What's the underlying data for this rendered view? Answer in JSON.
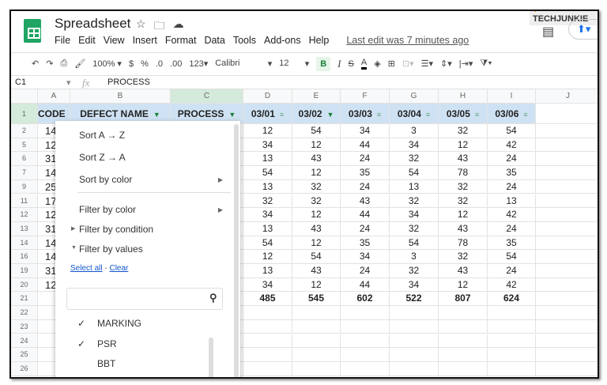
{
  "app": {
    "title": "Spreadsheet",
    "last_edit": "Last edit was 7 minutes ago",
    "brand": "TECHJUNKIE"
  },
  "menu": [
    "File",
    "Edit",
    "View",
    "Insert",
    "Format",
    "Data",
    "Tools",
    "Add-ons",
    "Help"
  ],
  "toolbar": {
    "zoom": "100%",
    "currency": "$",
    "percent": "%",
    "dec_less": ".0",
    "dec_more": ".00",
    "format": "123",
    "font": "Calibri",
    "size": "12",
    "bold": "B",
    "italic": "I",
    "strike": "S",
    "text_color": "A"
  },
  "formula": {
    "cell": "C1",
    "fx": "fx",
    "value": "PROCESS"
  },
  "columns": [
    "A",
    "B",
    "C",
    "D",
    "E",
    "F",
    "G",
    "H",
    "I",
    "J"
  ],
  "headers": [
    "CODE",
    "DEFECT NAME",
    "PROCESS",
    "03/01",
    "03/02",
    "03/03",
    "03/04",
    "03/05",
    "03/06"
  ],
  "row_numbers": [
    "1",
    "2",
    "5",
    "6",
    "7",
    "9",
    "11",
    "12",
    "13",
    "14",
    "16",
    "19",
    "20",
    "21",
    "22",
    "23",
    "24",
    "25",
    "26"
  ],
  "col_a": [
    "14",
    "12",
    "31",
    "14",
    "25",
    "17",
    "12",
    "31",
    "14",
    "14",
    "31",
    "12"
  ],
  "data": [
    [
      12,
      54,
      34,
      3,
      32,
      54
    ],
    [
      34,
      12,
      44,
      34,
      12,
      42
    ],
    [
      13,
      43,
      24,
      32,
      43,
      24
    ],
    [
      54,
      12,
      35,
      54,
      78,
      35
    ],
    [
      13,
      32,
      24,
      13,
      32,
      24
    ],
    [
      32,
      32,
      43,
      32,
      32,
      13
    ],
    [
      34,
      12,
      44,
      34,
      12,
      42
    ],
    [
      13,
      43,
      24,
      32,
      43,
      24
    ],
    [
      54,
      12,
      35,
      54,
      78,
      35
    ],
    [
      12,
      54,
      34,
      3,
      32,
      54
    ],
    [
      13,
      43,
      24,
      32,
      43,
      24
    ],
    [
      34,
      12,
      44,
      34,
      12,
      42
    ]
  ],
  "totals": [
    485,
    545,
    602,
    522,
    807,
    624
  ],
  "filter_menu": {
    "sort_az": "Sort A → Z",
    "sort_za": "Sort Z → A",
    "sort_color": "Sort by color",
    "filter_color": "Filter by color",
    "filter_condition": "Filter by condition",
    "filter_values": "Filter by values",
    "select_all": "Select all",
    "sep": " - ",
    "clear": "Clear",
    "search_placeholder": "",
    "values": [
      {
        "label": "MARKING",
        "checked": true
      },
      {
        "label": "PSR",
        "checked": true
      },
      {
        "label": "BBT",
        "checked": false
      }
    ]
  },
  "colors": {
    "header_fill": "#cfe2f3",
    "filter_green": "#188038",
    "link": "#1155cc"
  }
}
